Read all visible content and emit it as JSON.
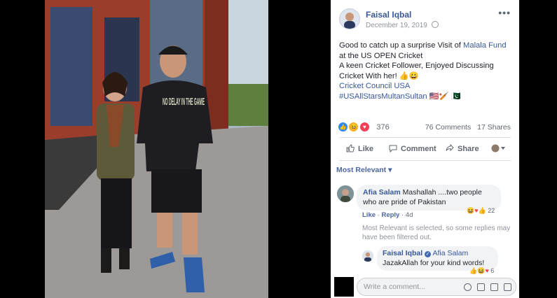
{
  "post": {
    "author": "Faisal Iqbal",
    "date": "December 19, 2019",
    "line1_pre": "Good to catch up a surprise Visit of ",
    "line1_link": "Malala Fund",
    "line1_post": " at the US OPEN Cricket",
    "line2": "A keen Cricket Follower, Enjoyed Discussing Cricket With her! 👍😀",
    "page_link": "Cricket Council USA",
    "hashtag": "#USAllStarsMultanSultan",
    "flags": "🇺🇸🏏 🇵🇰",
    "photo_shirt_text": "NO DELAY IN THE GAME"
  },
  "reactions": {
    "count": "376",
    "comments": "76 Comments",
    "shares": "17 Shares"
  },
  "actions": {
    "like": "Like",
    "comment": "Comment",
    "share": "Share"
  },
  "comments_filter": "Most Relevant ▾",
  "comments": [
    {
      "name": "Afia Salam",
      "text": "Mashallah ....two people who are pride of Pakistan",
      "like": "Like",
      "reply": "Reply",
      "time": "4d",
      "reactions": "22",
      "filter_note": "Most Relevant is selected, so some replies may have been filtered out."
    }
  ],
  "reply": {
    "name": "Faisal Iqbal",
    "tag": "Afia Salam",
    "text": "JazakAllah for your kind words!",
    "reactions": "6"
  },
  "composer": {
    "placeholder": "Write a comment..."
  },
  "colors": {
    "link": "#385898",
    "secondary": "#606770",
    "like_blue": "#2d88ff",
    "love_red": "#f33e58",
    "haha_yellow": "#f7b125"
  }
}
